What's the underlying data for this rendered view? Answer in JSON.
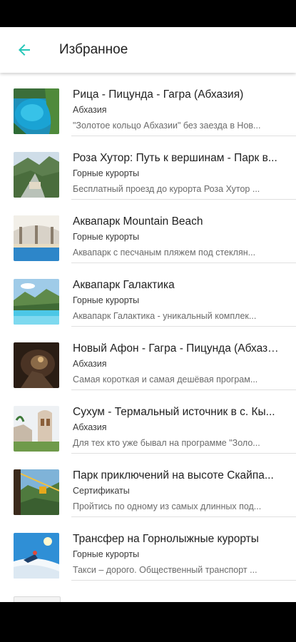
{
  "header": {
    "title": "Избранное",
    "accent_color": "#26c6b8"
  },
  "items": [
    {
      "title": "Рица - Пицунда - Гагра (Абхазия)",
      "category": "Абхазия",
      "description": "\"Золотое кольцо Абхазии\" без заезда в Нов..."
    },
    {
      "title": "Роза Хутор: Путь к вершинам - Парк в...",
      "category": "Горные курорты",
      "description": "Бесплатный проезд до курорта Роза Хутор ..."
    },
    {
      "title": "Аквапарк Mountain Beach",
      "category": "Горные курорты",
      "description": "Аквапарк с песчаным пляжем под стеклян..."
    },
    {
      "title": "Аквапарк Галактика",
      "category": "Горные курорты",
      "description": "Аквапарк Галактика - уникальный комплек..."
    },
    {
      "title": "Новый Афон - Гагра - Пицунда (Абхази...",
      "category": "Абхазия",
      "description": "Самая короткая и самая дешёвая програм..."
    },
    {
      "title": "Сухум - Термальный источник в с. Кы...",
      "category": "Абхазия",
      "description": "Для тех кто уже бывал на программе \"Золо..."
    },
    {
      "title": "Парк приключений на высоте Скайпа...",
      "category": "Сертификаты",
      "description": "Пройтись по одному из самых длинных под..."
    },
    {
      "title": "Трансфер на Горнолыжные курорты",
      "category": "Горные курорты",
      "description": "Такси – дорого. Общественный транспорт ..."
    }
  ]
}
